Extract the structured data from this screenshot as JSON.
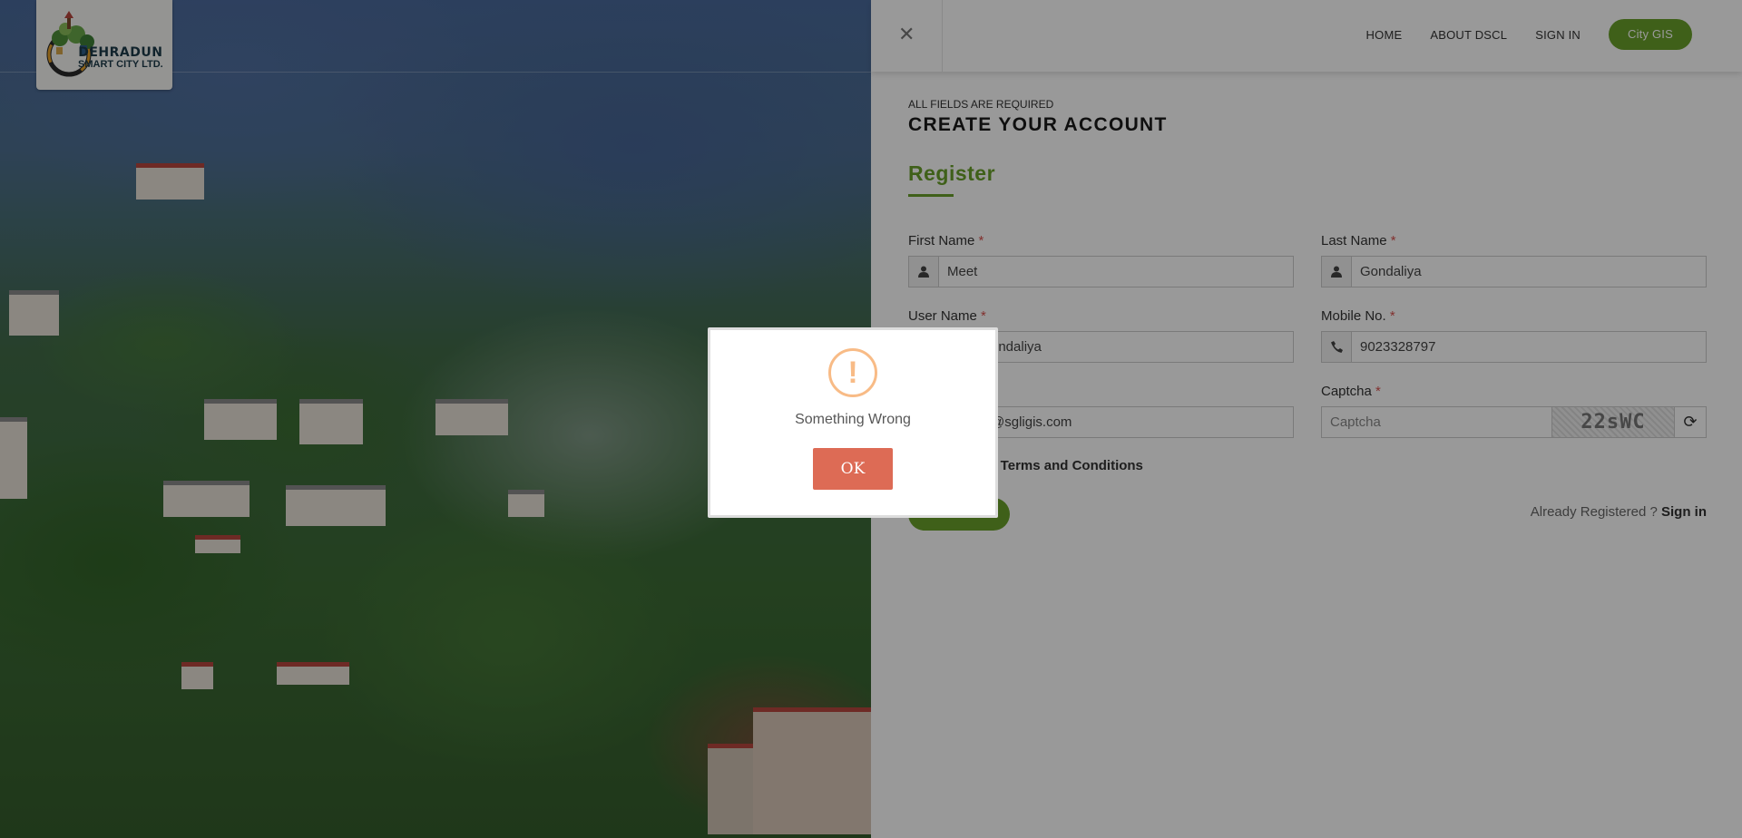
{
  "logo": {
    "line1": "DEHRADUN",
    "line2": "SMART CITY LTD."
  },
  "nav": {
    "home": "HOME",
    "about": "ABOUT DSCL",
    "signin": "SIGN IN",
    "gis": "City GIS"
  },
  "form": {
    "required_note": "ALL FIELDS ARE REQUIRED",
    "title": "CREATE YOUR ACCOUNT",
    "section": "Register",
    "first_name": {
      "label": "First Name",
      "value": "Meet",
      "icon": "user-icon"
    },
    "last_name": {
      "label": "Last Name",
      "value": "Gondaliya",
      "icon": "user-icon"
    },
    "user_name": {
      "label": "User Name",
      "value": "ondaliya"
    },
    "mobile": {
      "label": "Mobile No.",
      "value": "9023328797",
      "icon": "phone-icon"
    },
    "email": {
      "value": "@sgligis.com"
    },
    "captcha": {
      "label": "Captcha",
      "placeholder": "Captcha",
      "image_text": "22sWC",
      "refresh_icon": "refresh-icon"
    },
    "terms": "he Terms and Conditions",
    "required_star": "*",
    "already": "Already Registered ?",
    "signin_link": "Sign in"
  },
  "modal": {
    "icon": "!",
    "message": "Something Wrong",
    "ok": "OK"
  },
  "colors": {
    "accent": "#6aa12b",
    "danger_button": "#dd6b55",
    "warning_icon": "#f8bb86"
  }
}
